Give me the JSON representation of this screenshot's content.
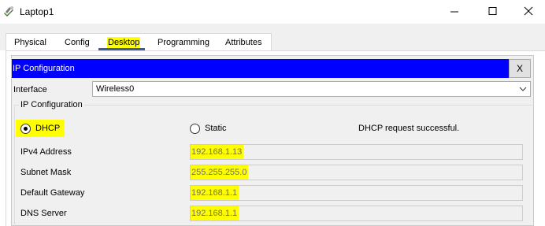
{
  "window": {
    "title": "Laptop1",
    "controls": {
      "minimize": "minimize-icon",
      "maximize": "maximize-icon",
      "close": "close-icon"
    }
  },
  "tabs": [
    {
      "label": "Physical",
      "active": false
    },
    {
      "label": "Config",
      "active": false
    },
    {
      "label": "Desktop",
      "active": true
    },
    {
      "label": "Programming",
      "active": false
    },
    {
      "label": "Attributes",
      "active": false
    }
  ],
  "ip_config": {
    "header_title": "IP Configuration",
    "close_label": "X",
    "interface_label": "Interface",
    "interface_value": "Wireless0",
    "group_label": "IP Configuration",
    "dhcp_label": "DHCP",
    "dhcp_selected": true,
    "static_label": "Static",
    "status_text": "DHCP request successful.",
    "fields": [
      {
        "label": "IPv4 Address",
        "value": "192.168.1.13"
      },
      {
        "label": "Subnet Mask",
        "value": "255.255.255.0"
      },
      {
        "label": "Default Gateway",
        "value": "192.168.1.1"
      },
      {
        "label": "DNS Server",
        "value": "192.168.1.1"
      }
    ]
  },
  "colors": {
    "header_bg": "#0000ff",
    "highlight": "#ffff00",
    "active_tab_underline": "#3d5d96"
  }
}
